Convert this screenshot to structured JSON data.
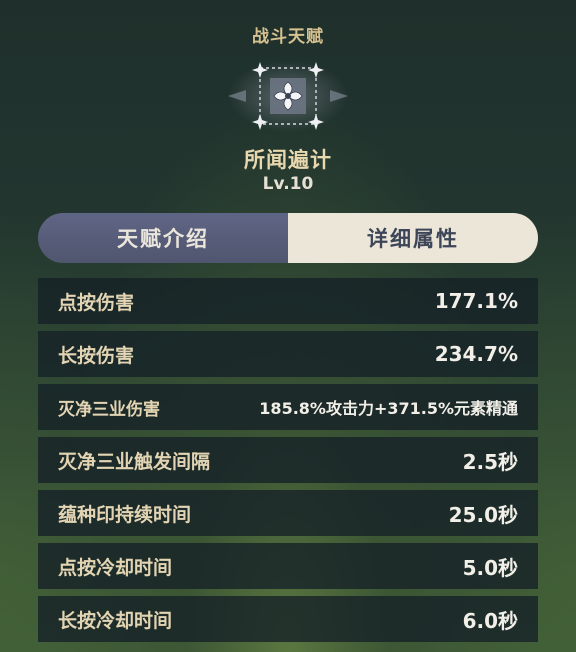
{
  "header": {
    "title": "战斗天赋"
  },
  "talent": {
    "icon": "talent-emblem-icon",
    "name": "所闻遍计",
    "level": "Lv.10"
  },
  "tabs": [
    {
      "label": "天赋介绍",
      "active": false
    },
    {
      "label": "详细属性",
      "active": true
    }
  ],
  "stats": [
    {
      "label": "点按伤害",
      "value": "177.1%"
    },
    {
      "label": "长按伤害",
      "value": "234.7%"
    },
    {
      "label": "灭净三业伤害",
      "value": "185.8%攻击力+371.5%元素精通"
    },
    {
      "label": "灭净三业触发间隔",
      "value": "2.5秒"
    },
    {
      "label": "蕴种印持续时间",
      "value": "25.0秒"
    },
    {
      "label": "点按冷却时间",
      "value": "5.0秒"
    },
    {
      "label": "长按冷却时间",
      "value": "6.0秒"
    }
  ],
  "colors": {
    "accent_gold": "#d7c190",
    "tab_active_bg": "#ece6d8",
    "tab_inactive_bg": "#5f6584",
    "row_bg": "#142026"
  }
}
